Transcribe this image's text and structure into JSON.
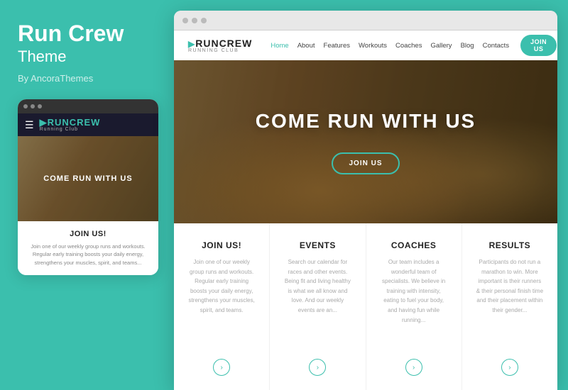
{
  "leftPanel": {
    "title": "Run Crew",
    "subtitle": "Theme",
    "by": "By AncoraThemes"
  },
  "mobilePreview": {
    "dots": [
      "dot1",
      "dot2",
      "dot3"
    ],
    "nav": {
      "logoMain": "RUNCREW",
      "logoSub": "Running Club"
    },
    "hero": {
      "text": "COME RUN WITH US"
    },
    "content": {
      "joinTitle": "JOIN US!",
      "joinText": "Join one of our weekly group runs and workouts. Regular early training boosts your daily energy, strengthens your muscles, spirit, and teams..."
    }
  },
  "browser": {
    "dots": [
      "dot1",
      "dot2",
      "dot3"
    ],
    "nav": {
      "logoMain": "RUNCREW",
      "logoSub": "Running Club",
      "links": [
        "Home",
        "About",
        "Features",
        "Workouts",
        "Coaches",
        "Gallery",
        "Blog",
        "Contacts"
      ],
      "ctaLabel": "JOIN US"
    },
    "hero": {
      "title": "COME RUN WITH US",
      "btnLabel": "JOIN US"
    },
    "cards": [
      {
        "title": "JOIN US!",
        "text": "Join one of our weekly group runs and workouts. Regular early training boosts your daily energy, strengthens your muscles, spirit, and teams.",
        "icon": "+"
      },
      {
        "title": "EVENTS",
        "text": "Search our calendar for races and other events. Being fit and living healthy is what we all know and love. And our weekly events are an...",
        "icon": "+"
      },
      {
        "title": "COACHES",
        "text": "Our team includes a wonderful team of specialists. We believe in training with intensity, eating to fuel your body, and having fun while running...",
        "icon": "+"
      },
      {
        "title": "RESULTS",
        "text": "Participants do not run a marathon to win. More important is their runners & their personal finish time and their placement within their gender...",
        "icon": "+"
      }
    ]
  }
}
